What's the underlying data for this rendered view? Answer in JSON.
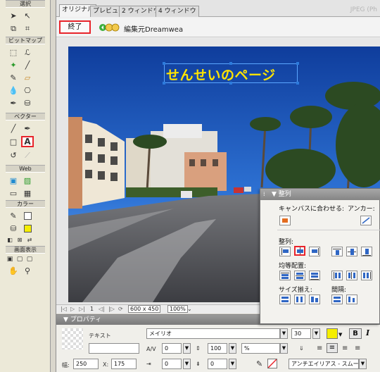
{
  "toolbox": {
    "sections": {
      "bitmap": "ビットマップ",
      "vector": "ベクター",
      "web": "Web",
      "color": "カラー",
      "view": "画面表示"
    }
  },
  "tabs": [
    "オリジナル",
    "プレビュー",
    "2 ウィンドウ",
    "4 ウィンドウ"
  ],
  "doc_format": "JPEG (Ph",
  "toolbar": {
    "done_label": "終了",
    "edit_source_label": "編集元Dreamwea"
  },
  "canvas": {
    "overlay_text": "せんせいのページ"
  },
  "statusbar": {
    "page": "1",
    "size": "600 x 450",
    "zoom": "100%"
  },
  "properties": {
    "title": "プロパティ",
    "type_label": "テキスト",
    "font": "メイリオ",
    "font_size": "30",
    "kerning": "0",
    "leading": "100",
    "leading_unit": "%",
    "indent": "0",
    "space_after": "0",
    "width_label": "幅:",
    "width_value": "250",
    "x_label": "X:",
    "x_value": "175",
    "antialias": "アンチエイリアス - スムーズ",
    "bold_label": "B",
    "italic_label": "I",
    "fill_color": "#f5ee00"
  },
  "align_panel": {
    "title": "整列",
    "fit_canvas": "キャンバスに合わせる:",
    "anchor": "アンカー:",
    "align_label": "整列:",
    "distribute_label": "均等配置:",
    "size_label": "サイズ揃え:",
    "spacing_label": "間隔:"
  },
  "colors": {
    "highlight": "#e8242b",
    "stroke_swatch": "#ffffff",
    "fill_swatch": "#f5ee00",
    "text_overlay": "#ffe400"
  }
}
